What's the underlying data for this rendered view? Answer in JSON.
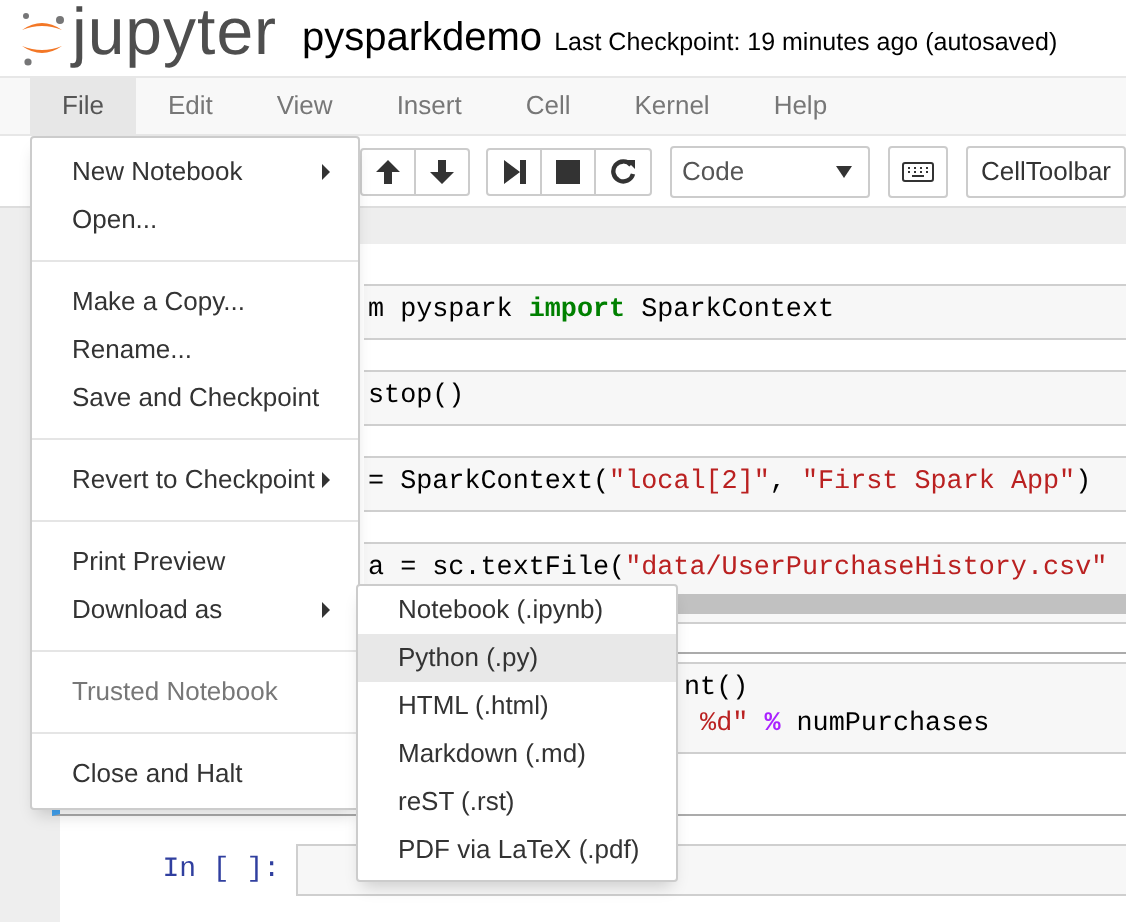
{
  "header": {
    "logo_text": "jupyter",
    "notebook_name": "pysparkdemo",
    "checkpoint_status": "Last Checkpoint: 19 minutes ago (autosaved)"
  },
  "menubar": [
    {
      "label": "File",
      "selected": true
    },
    {
      "label": "Edit",
      "selected": false
    },
    {
      "label": "View",
      "selected": false
    },
    {
      "label": "Insert",
      "selected": false
    },
    {
      "label": "Cell",
      "selected": false
    },
    {
      "label": "Kernel",
      "selected": false
    },
    {
      "label": "Help",
      "selected": false
    }
  ],
  "toolbar": {
    "cell_type": "Code",
    "cell_toolbar": "CellToolbar"
  },
  "cells": [
    {
      "kind": "under-menu",
      "selected": false,
      "lines": [
        [
          {
            "kind": "plain",
            "text": "m pyspark "
          },
          {
            "kind": "keyword",
            "text": "import"
          },
          {
            "kind": "plain",
            "text": " SparkContext"
          }
        ]
      ]
    },
    {
      "kind": "under-menu",
      "selected": false,
      "lines": [
        [
          {
            "kind": "plain",
            "text": "stop()"
          }
        ]
      ]
    },
    {
      "kind": "under-menu",
      "selected": false,
      "lines": [
        [
          {
            "kind": "plain",
            "text": "= SparkContext("
          },
          {
            "kind": "string",
            "text": "\"local[2]\""
          },
          {
            "kind": "plain",
            "text": ", "
          },
          {
            "kind": "string",
            "text": "\"First Spark App\""
          },
          {
            "kind": "plain",
            "text": ")"
          }
        ]
      ]
    },
    {
      "kind": "under-menu",
      "selected": false,
      "scrollbar": true,
      "lines": [
        [
          {
            "kind": "plain",
            "text": "a = sc.textFile("
          },
          {
            "kind": "string",
            "text": "\"data/UserPurchaseHistory.csv\""
          }
        ]
      ]
    },
    {
      "kind": "under-submenu",
      "selected": true,
      "lines": [
        [
          {
            "kind": "plain",
            "text": "nt()"
          }
        ],
        [
          {
            "kind": "string",
            "text": " %d\""
          },
          {
            "kind": "operator",
            "text": " %"
          },
          {
            "kind": "plain",
            "text": " numPurchases"
          }
        ]
      ]
    },
    {
      "kind": "free",
      "selected": false,
      "prompt": "In [ ]:"
    }
  ],
  "file_menu": [
    {
      "kind": "item",
      "label": "New Notebook",
      "submenu": true,
      "disabled": false
    },
    {
      "kind": "item",
      "label": "Open...",
      "submenu": false,
      "disabled": false
    },
    {
      "kind": "divider"
    },
    {
      "kind": "item",
      "label": "Make a Copy...",
      "submenu": false,
      "disabled": false
    },
    {
      "kind": "item",
      "label": "Rename...",
      "submenu": false,
      "disabled": false
    },
    {
      "kind": "item",
      "label": "Save and Checkpoint",
      "submenu": false,
      "disabled": false
    },
    {
      "kind": "divider"
    },
    {
      "kind": "item",
      "label": "Revert to Checkpoint",
      "submenu": true,
      "disabled": false
    },
    {
      "kind": "divider"
    },
    {
      "kind": "item",
      "label": "Print Preview",
      "submenu": false,
      "disabled": false
    },
    {
      "kind": "item",
      "label": "Download as",
      "submenu": true,
      "disabled": false
    },
    {
      "kind": "divider"
    },
    {
      "kind": "item",
      "label": "Trusted Notebook",
      "submenu": false,
      "disabled": true
    },
    {
      "kind": "divider"
    },
    {
      "kind": "item",
      "label": "Close and Halt",
      "submenu": false,
      "disabled": false
    }
  ],
  "download_submenu": [
    {
      "label": "Notebook (.ipynb)",
      "selected": false
    },
    {
      "label": "Python (.py)",
      "selected": true
    },
    {
      "label": "HTML (.html)",
      "selected": false
    },
    {
      "label": "Markdown (.md)",
      "selected": false
    },
    {
      "label": "reST (.rst)",
      "selected": false
    },
    {
      "label": "PDF via LaTeX (.pdf)",
      "selected": false
    }
  ]
}
